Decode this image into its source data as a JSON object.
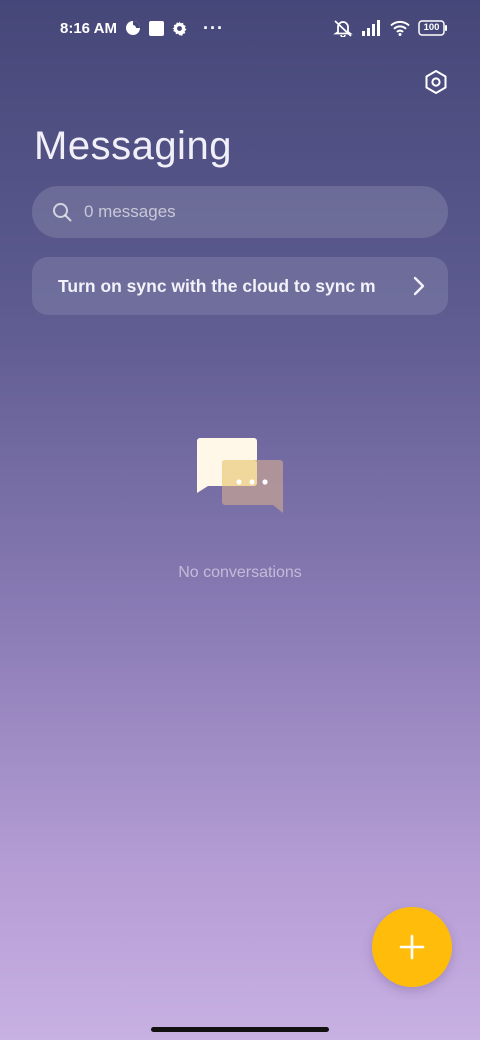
{
  "status_bar": {
    "time": "8:16 AM",
    "more_dots": "···",
    "battery": "100",
    "icons": [
      "data-saver-icon",
      "square-notification-icon",
      "gear-notification-icon",
      "silent-bell-icon",
      "signal-icon",
      "wifi-icon",
      "battery-icon"
    ]
  },
  "header": {
    "title": "Messaging",
    "settings_icon": "hexagon-settings-icon"
  },
  "search": {
    "placeholder": "0 messages",
    "icon": "search-icon"
  },
  "sync_banner": {
    "text": "Turn on sync with the cloud to sync messages",
    "icon": "chevron-right-icon"
  },
  "empty_state": {
    "text": "No conversations",
    "icon": "chat-bubbles-icon"
  },
  "fab": {
    "icon": "plus-icon",
    "color": "#ffbc0a"
  }
}
